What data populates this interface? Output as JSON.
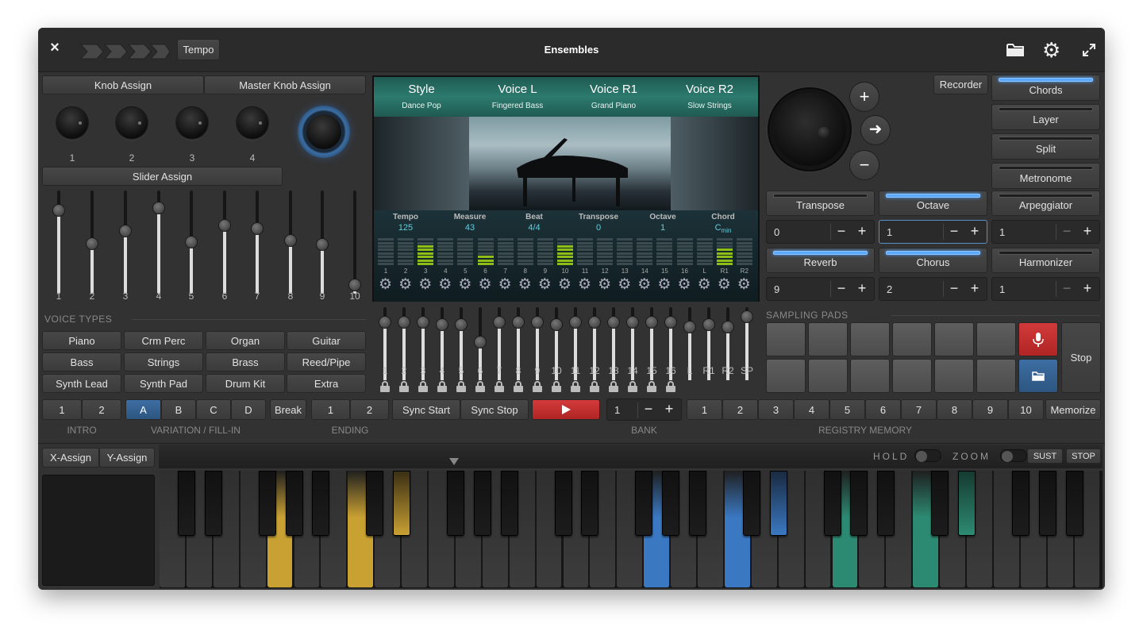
{
  "window": {
    "title": "Ensembles"
  },
  "titlebar": {
    "close": "×",
    "tempo_button": "Tempo"
  },
  "knob_panel": {
    "knob_assign": "Knob Assign",
    "master_knob_assign": "Master Knob Assign",
    "knob_labels": [
      "1",
      "2",
      "3",
      "4"
    ],
    "slider_assign": "Slider Assign",
    "slider_labels": [
      "1",
      "2",
      "3",
      "4",
      "5",
      "6",
      "7",
      "8",
      "9",
      "10"
    ],
    "slider_levels": [
      0.85,
      0.48,
      0.62,
      0.88,
      0.5,
      0.68,
      0.65,
      0.52,
      0.47,
      0.03
    ]
  },
  "voice_types": {
    "heading": "VOICE TYPES",
    "buttons": [
      "Piano",
      "Crm Perc",
      "Organ",
      "Guitar",
      "Bass",
      "Strings",
      "Brass",
      "Reed/Pipe",
      "Synth Lead",
      "Synth Pad",
      "Drum Kit",
      "Extra"
    ]
  },
  "display": {
    "header": [
      {
        "title": "Style",
        "value": "Dance Pop"
      },
      {
        "title": "Voice L",
        "value": "Fingered Bass"
      },
      {
        "title": "Voice R1",
        "value": "Grand Piano"
      },
      {
        "title": "Voice R2",
        "value": "Slow Strings"
      }
    ],
    "info": [
      {
        "label": "Tempo",
        "value": "125"
      },
      {
        "label": "Measure",
        "value": "43"
      },
      {
        "label": "Beat",
        "value": "4/4"
      },
      {
        "label": "Transpose",
        "value": "0"
      },
      {
        "label": "Octave",
        "value": "1"
      },
      {
        "label": "Chord",
        "value": "C",
        "sub": "min"
      }
    ],
    "channels": [
      "1",
      "2",
      "3",
      "4",
      "5",
      "6",
      "7",
      "8",
      "9",
      "10",
      "11",
      "12",
      "13",
      "14",
      "15",
      "16",
      "L",
      "R1",
      "R2"
    ],
    "channel_levels": [
      0,
      0,
      0.75,
      0,
      0,
      0.38,
      0,
      0,
      0,
      0.75,
      0,
      0,
      0,
      0,
      0,
      0,
      0,
      0.62,
      0
    ]
  },
  "mixer": {
    "labels": [
      "1",
      "2",
      "3",
      "4",
      "5",
      "6",
      "7",
      "8",
      "9",
      "10",
      "11",
      "12",
      "13",
      "14",
      "15",
      "16",
      "L",
      "R1",
      "R2",
      "SP"
    ],
    "levels": [
      0.85,
      0.85,
      0.85,
      0.82,
      0.82,
      0.52,
      0.85,
      0.85,
      0.85,
      0.82,
      0.85,
      0.85,
      0.85,
      0.85,
      0.85,
      0.85,
      0.78,
      0.82,
      0.78,
      0.95
    ]
  },
  "right_panel": {
    "recorder": "Recorder",
    "side_toggles": [
      {
        "label": "Chords",
        "on": true
      },
      {
        "label": "Layer",
        "on": false
      },
      {
        "label": "Split",
        "on": false
      },
      {
        "label": "Metronome",
        "on": false
      }
    ],
    "row1": [
      {
        "label": "Transpose",
        "on": false,
        "value": "0"
      },
      {
        "label": "Octave",
        "on": true,
        "value": "1"
      },
      {
        "label": "Arpeggiator",
        "on": false,
        "value": "1"
      }
    ],
    "row2": [
      {
        "label": "Reverb",
        "on": true,
        "value": "9"
      },
      {
        "label": "Chorus",
        "on": true,
        "value": "2"
      },
      {
        "label": "Harmonizer",
        "on": false,
        "value": "1"
      }
    ],
    "minus": "−",
    "plus": "+"
  },
  "sampling_pads": {
    "heading": "SAMPLING PADS",
    "stop": "Stop"
  },
  "transport": {
    "intro": [
      "1",
      "2"
    ],
    "variation": [
      "A",
      "B",
      "C",
      "D"
    ],
    "break": "Break",
    "ending": [
      "1",
      "2"
    ],
    "sync_start": "Sync Start",
    "sync_stop": "Sync Stop",
    "bank_value": "1",
    "registry": [
      "1",
      "2",
      "3",
      "4",
      "5",
      "6",
      "7",
      "8",
      "9",
      "10"
    ],
    "memorize": "Memorize",
    "labels": {
      "intro": "INTRO",
      "variation": "VARIATION / FILL-IN",
      "ending": "ENDING",
      "bank": "BANK",
      "registry": "REGISTRY MEMORY"
    }
  },
  "keyboard_bar": {
    "x_assign": "X-Assign",
    "y_assign": "Y-Assign",
    "hold": "HOLD",
    "zoom": "ZOOM",
    "sust": "SUST",
    "stop": "STOP"
  },
  "colors": {
    "accent_blue": "#3d6ea3",
    "play_red": "#d23a3a",
    "meter_green": "#8dbd16",
    "key_yellow": "#c9a032",
    "key_blue": "#3a78c2",
    "key_teal": "#2d8a72"
  }
}
